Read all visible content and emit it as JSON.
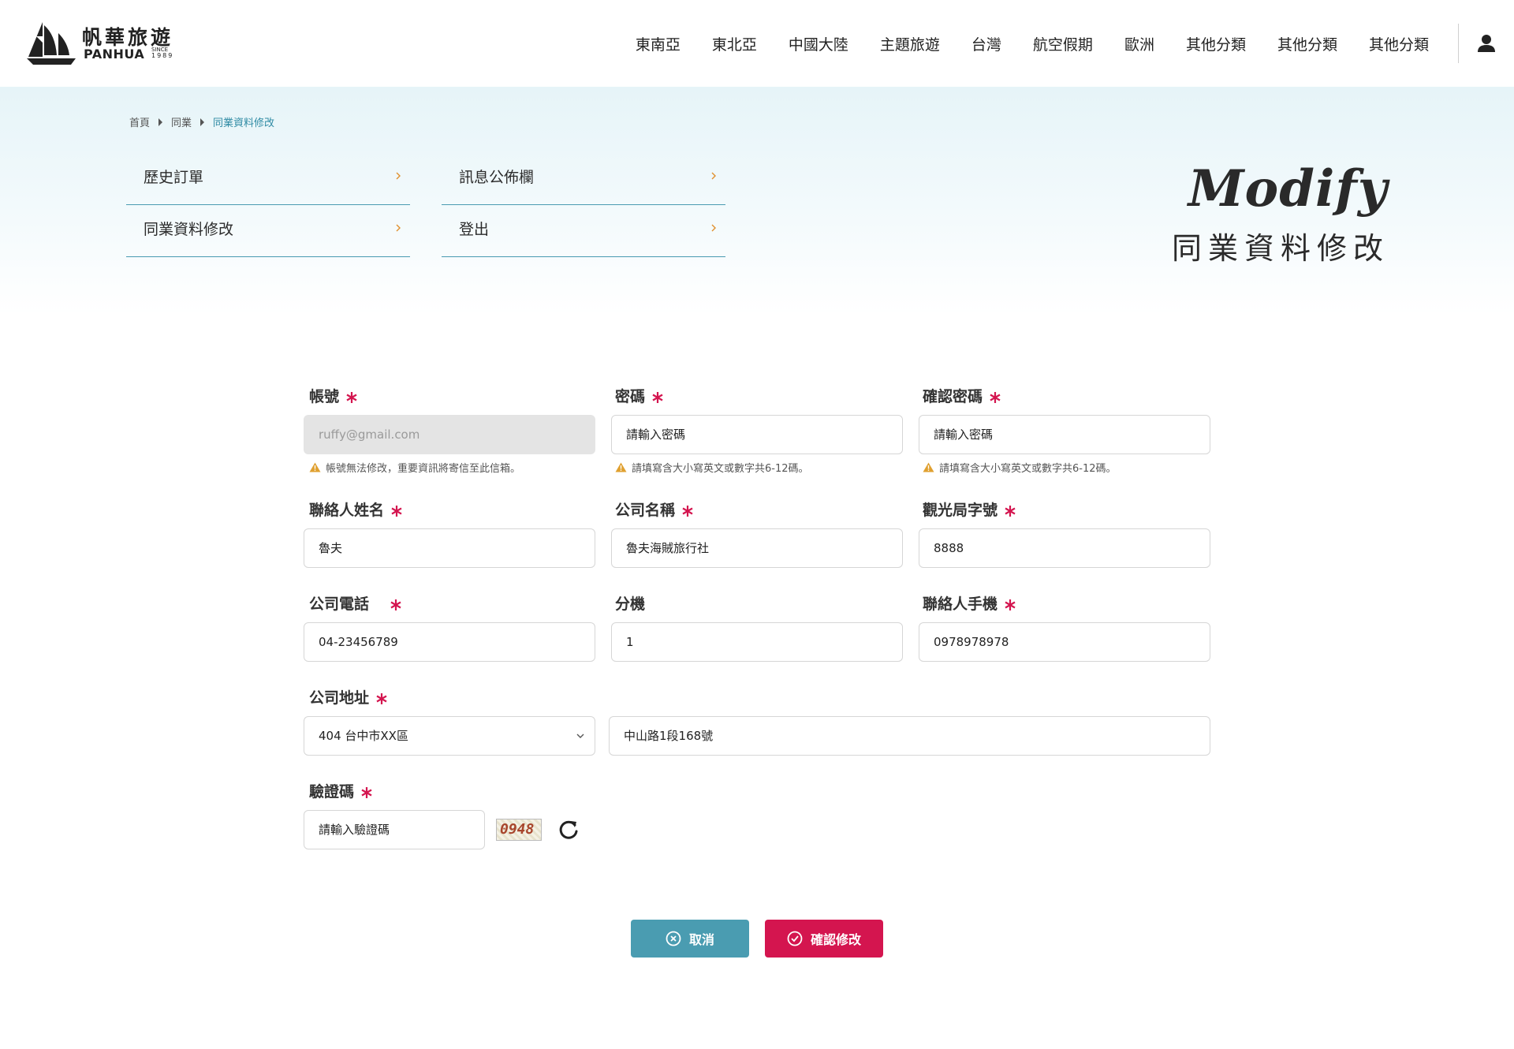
{
  "brand": {
    "name_cn": "帆華旅遊",
    "name_en": "PANHUA",
    "since_label": "SINCE",
    "since_year": "1989"
  },
  "nav": {
    "items": [
      "東南亞",
      "東北亞",
      "中國大陸",
      "主題旅遊",
      "台灣",
      "航空假期",
      "歐洲",
      "其他分類",
      "其他分類",
      "其他分類"
    ]
  },
  "breadcrumb": {
    "home": "首頁",
    "section": "同業",
    "current": "同業資料修改"
  },
  "side_menu": {
    "order_history": "歷史訂單",
    "bulletin": "訊息公佈欄",
    "modify_profile": "同業資料修改",
    "logout": "登出"
  },
  "page_title": {
    "en": "Modify",
    "cn": "同業資料修改"
  },
  "form": {
    "account": {
      "label": "帳號",
      "value": "ruffy@gmail.com",
      "hint": "帳號無法修改，重要資訊將寄信至此信箱。"
    },
    "password": {
      "label": "密碼",
      "placeholder": "請輸入密碼",
      "hint": "請填寫含大小寫英文或數字共6-12碼。"
    },
    "confirm_password": {
      "label": "確認密碼",
      "placeholder": "請輸入密碼",
      "hint": "請填寫含大小寫英文或數字共6-12碼。"
    },
    "contact_name": {
      "label": "聯絡人姓名",
      "value": "魯夫"
    },
    "company_name": {
      "label": "公司名稱",
      "value": "魯夫海賊旅行社"
    },
    "tourism_license": {
      "label": "觀光局字號",
      "value": "8888"
    },
    "company_phone": {
      "label": "公司電話",
      "value": "04-23456789"
    },
    "extension": {
      "label": "分機",
      "value": "1"
    },
    "contact_mobile": {
      "label": "聯絡人手機",
      "value": "0978978978"
    },
    "company_address": {
      "label": "公司地址",
      "district": "404 台中市XX區",
      "street": "中山路1段168號"
    },
    "captcha": {
      "label": "驗證碼",
      "placeholder": "請輸入驗證碼",
      "image_text": "0948"
    }
  },
  "buttons": {
    "cancel": "取消",
    "confirm": "確認修改"
  },
  "colors": {
    "accent_teal": "#4a9cb1",
    "accent_red": "#d4154f",
    "required_star": "#d4154f",
    "warning": "#e0a030"
  }
}
